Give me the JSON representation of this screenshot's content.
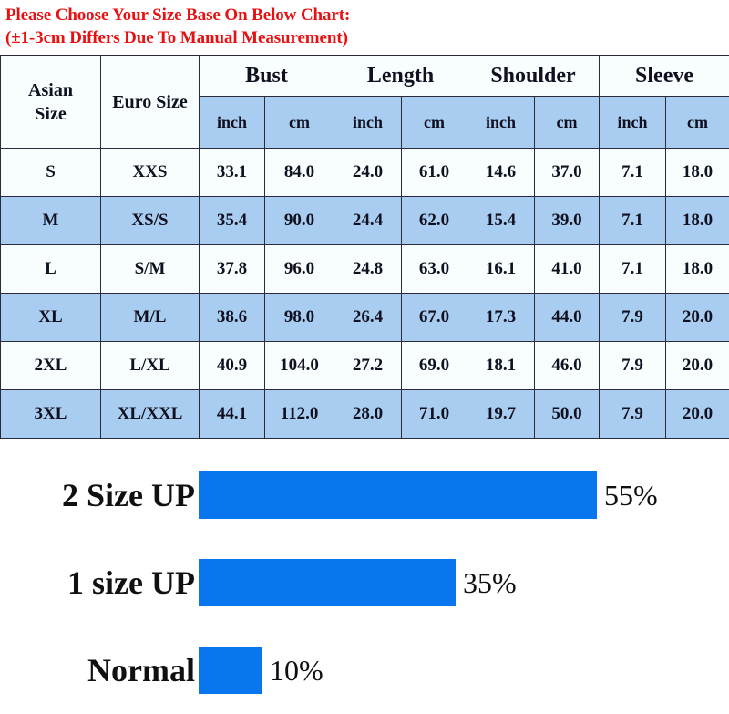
{
  "heading": {
    "line1": "Please Choose Your Size Base On Below Chart:",
    "line2": "(±1-3cm Differs Due To Manual Measurement)",
    "color": "#e81010"
  },
  "size_table": {
    "corner_headers": {
      "asian_size_line1": "Asian",
      "asian_size_line2": "Size",
      "euro_size": "Euro Size"
    },
    "group_headers": [
      "Bust",
      "Length",
      "Shoulder",
      "Sleeve"
    ],
    "unit_headers": [
      "inch",
      "cm",
      "inch",
      "cm",
      "inch",
      "cm",
      "inch",
      "cm"
    ],
    "rows": [
      {
        "asian": "S",
        "euro": "XXS",
        "bust_inch": "33.1",
        "bust_cm": "84.0",
        "length_inch": "24.0",
        "length_cm": "61.0",
        "shoulder_inch": "14.6",
        "shoulder_cm": "37.0",
        "sleeve_inch": "7.1",
        "sleeve_cm": "18.0",
        "shade": "white"
      },
      {
        "asian": "M",
        "euro": "XS/S",
        "bust_inch": "35.4",
        "bust_cm": "90.0",
        "length_inch": "24.4",
        "length_cm": "62.0",
        "shoulder_inch": "15.4",
        "shoulder_cm": "39.0",
        "sleeve_inch": "7.1",
        "sleeve_cm": "18.0",
        "shade": "blue"
      },
      {
        "asian": "L",
        "euro": "S/M",
        "bust_inch": "37.8",
        "bust_cm": "96.0",
        "length_inch": "24.8",
        "length_cm": "63.0",
        "shoulder_inch": "16.1",
        "shoulder_cm": "41.0",
        "sleeve_inch": "7.1",
        "sleeve_cm": "18.0",
        "shade": "white"
      },
      {
        "asian": "XL",
        "euro": "M/L",
        "bust_inch": "38.6",
        "bust_cm": "98.0",
        "length_inch": "26.4",
        "length_cm": "67.0",
        "shoulder_inch": "17.3",
        "shoulder_cm": "44.0",
        "sleeve_inch": "7.9",
        "sleeve_cm": "20.0",
        "shade": "blue"
      },
      {
        "asian": "2XL",
        "euro": "L/XL",
        "bust_inch": "40.9",
        "bust_cm": "104.0",
        "length_inch": "27.2",
        "length_cm": "69.0",
        "shoulder_inch": "18.1",
        "shoulder_cm": "46.0",
        "sleeve_inch": "7.9",
        "sleeve_cm": "20.0",
        "shade": "white"
      },
      {
        "asian": "3XL",
        "euro": "XL/XXL",
        "bust_inch": "44.1",
        "bust_cm": "112.0",
        "length_inch": "28.0",
        "length_cm": "71.0",
        "shoulder_inch": "19.7",
        "shoulder_cm": "50.0",
        "sleeve_inch": "7.9",
        "sleeve_cm": "20.0",
        "shade": "blue"
      }
    ],
    "colors": {
      "row_blue": "#a8cdf0",
      "row_white": "#f8fdfd",
      "header_unit_blue": "#a8cdf0",
      "border": "#2a2a3a"
    }
  },
  "chart_data": {
    "type": "bar",
    "orientation": "horizontal",
    "title": "",
    "xlabel": "",
    "ylabel": "",
    "categories": [
      "2 Size UP",
      "1 size UP",
      "Normal"
    ],
    "values": [
      55,
      35,
      10
    ],
    "value_labels": [
      "55%",
      "35%",
      "10%"
    ],
    "unit": "%",
    "xlim": [
      0,
      70
    ],
    "grid": false,
    "legend": false,
    "bar_color": "#0a76ee",
    "bar_pixel_widths": [
      437,
      282,
      70
    ]
  }
}
